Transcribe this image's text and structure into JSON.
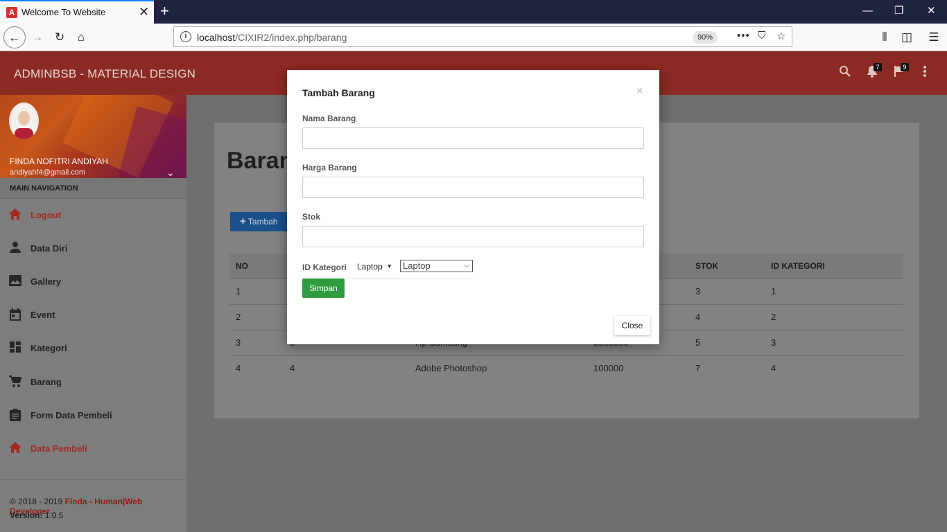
{
  "browser": {
    "tab_title": "Welcome To Website",
    "tab_close": "✕",
    "new_tab": "+",
    "url_host": "localhost",
    "url_path": "/CIXIR2/index.php/barang",
    "zoom": "90%",
    "win_min": "—",
    "win_max": "❐",
    "win_close": "✕"
  },
  "app": {
    "brand": "ADMINBSB - MATERIAL DESIGN",
    "notifications_count": "7",
    "tasks_count": "9"
  },
  "user": {
    "name": "FINDA NOFITRI ANDIYAH",
    "email": "andiyahf4@gmail.com"
  },
  "sidebar": {
    "header": "MAIN NAVIGATION",
    "items": [
      {
        "label": "Logout",
        "icon": "home-icon"
      },
      {
        "label": "Data Diri",
        "icon": "person-icon"
      },
      {
        "label": "Gallery",
        "icon": "image-icon"
      },
      {
        "label": "Event",
        "icon": "calendar-icon"
      },
      {
        "label": "Kategori",
        "icon": "dashboard-icon"
      },
      {
        "label": "Barang",
        "icon": "cart-icon"
      },
      {
        "label": "Form Data Pembeli",
        "icon": "clipboard-icon"
      },
      {
        "label": "Data Pembeli",
        "icon": "home-icon"
      }
    ],
    "footer": {
      "copyright_prefix": "© 2018 - 2019 ",
      "copyright_link": "Finda - Human|Web Developer",
      "copyright_suffix": ".",
      "version_label": "Version: ",
      "version": "1.0.5"
    }
  },
  "main": {
    "title": "Barang",
    "add_button": "Tambah",
    "table": {
      "headers": [
        "NO",
        "",
        "",
        "",
        "STOK",
        "ID KATEGORI"
      ],
      "rows": [
        [
          "1",
          "",
          "",
          "",
          "3",
          "1"
        ],
        [
          "2",
          "",
          "",
          "",
          "4",
          "2"
        ],
        [
          "3",
          "3",
          "Hp Samsung",
          "5000000",
          "5",
          "3"
        ],
        [
          "4",
          "4",
          "Adobe Photoshop",
          "100000",
          "7",
          "4"
        ]
      ]
    }
  },
  "modal": {
    "title": "Tambah Barang",
    "close_x": "×",
    "fields": {
      "nama_label": "Nama Barang",
      "nama_value": "",
      "harga_label": "Harga Barang",
      "harga_value": "",
      "stok_label": "Stok",
      "stok_value": ""
    },
    "kategori_label": "ID Kategori",
    "kategori_dropdown": "Laptop",
    "kategori_select": "Laptop",
    "submit": "Simpan",
    "close": "Close"
  }
}
